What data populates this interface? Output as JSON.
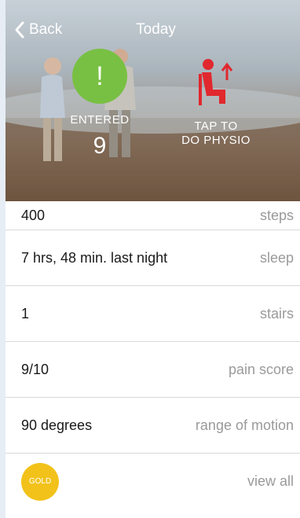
{
  "nav": {
    "back_label": "Back",
    "title": "Today"
  },
  "hero": {
    "status_label": "ENTERED",
    "status_value": "9",
    "physio_line1": "TAP TO",
    "physio_line2": "DO PHYSIO"
  },
  "metrics": [
    {
      "value": "400",
      "label": "steps"
    },
    {
      "value": "7 hrs, 48 min. last night",
      "label": "sleep"
    },
    {
      "value": "1",
      "label": "stairs"
    },
    {
      "value": "9/10",
      "label": "pain score"
    },
    {
      "value": "90 degrees",
      "label": "range of motion"
    }
  ],
  "footer": {
    "badge": "GOLD",
    "view_all": "view all"
  },
  "colors": {
    "status_green": "#78c043",
    "physio_red": "#e0282e",
    "badge_gold": "#f2c21a"
  }
}
